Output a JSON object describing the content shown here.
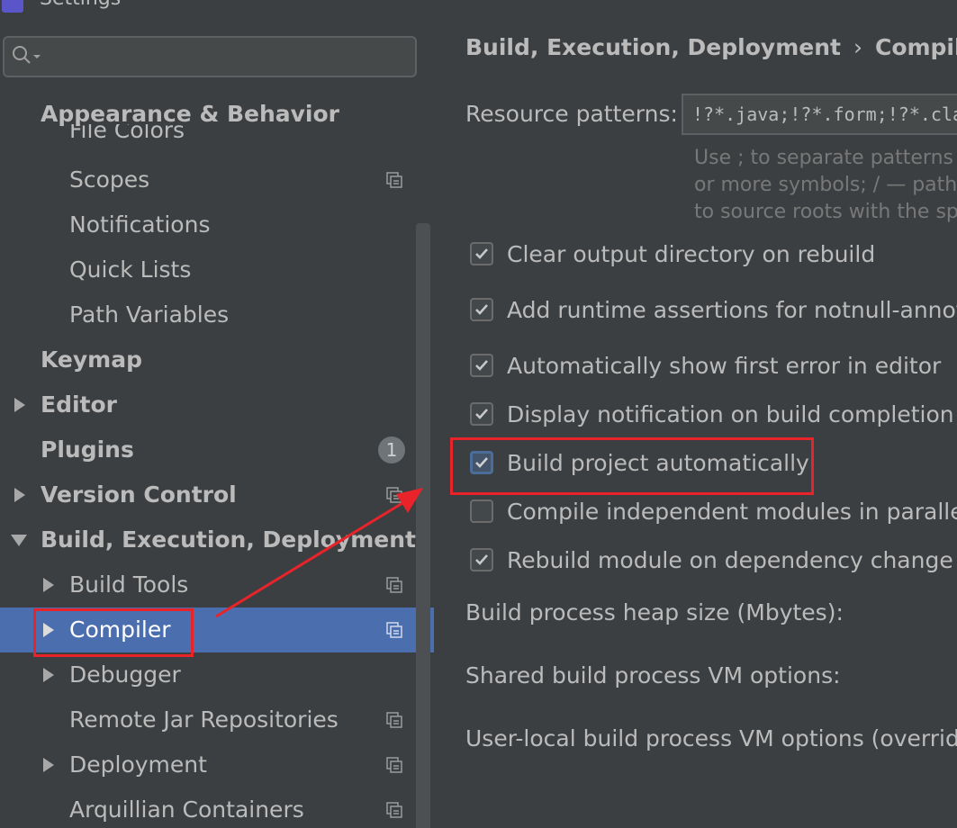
{
  "window": {
    "title": "Settings"
  },
  "search": {
    "placeholder": ""
  },
  "sidebar": {
    "items": [
      {
        "label": "Appearance & Behavior",
        "bold": true,
        "arrow": "none"
      },
      {
        "label": "File Colors",
        "arrow": "none"
      },
      {
        "label": "Scopes",
        "arrow": "none"
      },
      {
        "label": "Notifications",
        "arrow": "none"
      },
      {
        "label": "Quick Lists",
        "arrow": "none"
      },
      {
        "label": "Path Variables",
        "arrow": "none"
      },
      {
        "label": "Keymap",
        "bold": true,
        "arrow": "none"
      },
      {
        "label": "Editor",
        "bold": true,
        "arrow": "right"
      },
      {
        "label": "Plugins",
        "bold": true,
        "arrow": "none",
        "badge": "1"
      },
      {
        "label": "Version Control",
        "bold": true,
        "arrow": "right"
      },
      {
        "label": "Build, Execution, Deployment",
        "bold": true,
        "arrow": "down"
      },
      {
        "label": "Build Tools",
        "arrow": "right"
      },
      {
        "label": "Compiler",
        "arrow": "right",
        "selected": true
      },
      {
        "label": "Debugger",
        "arrow": "right"
      },
      {
        "label": "Remote Jar Repositories",
        "arrow": "none"
      },
      {
        "label": "Deployment",
        "arrow": "right"
      },
      {
        "label": "Arquillian Containers",
        "arrow": "none"
      }
    ]
  },
  "breadcrumb": {
    "parent": "Build, Execution, Deployment",
    "separator": "›",
    "current": "Compiler"
  },
  "resource": {
    "label": "Resource patterns:",
    "value": "!?*.java;!?*.form;!?*.class",
    "hint": [
      "Use ; to separate patterns ar",
      "or more symbols; / — path",
      "to source roots with the spe"
    ]
  },
  "options": [
    {
      "label": "Clear output directory on rebuild",
      "checked": true
    },
    {
      "label": "Add runtime assertions for notnull-annotate",
      "checked": true
    },
    {
      "label": "Automatically show first error in editor",
      "checked": true
    },
    {
      "label": "Display notification on build completion",
      "checked": true
    },
    {
      "label": "Build project automatically",
      "checked": true,
      "focused": true
    },
    {
      "label": "Compile independent modules in parallel",
      "checked": false
    },
    {
      "label": "Rebuild module on dependency change",
      "checked": true
    }
  ],
  "fields": {
    "heap": "Build process heap size (Mbytes):",
    "shared_vm": "Shared build process VM options:",
    "user_vm": "User-local build process VM options (overrides S"
  },
  "colors": {
    "selection": "#4b6eaf",
    "annotation": "#e8242a",
    "background": "#3c3f41"
  }
}
